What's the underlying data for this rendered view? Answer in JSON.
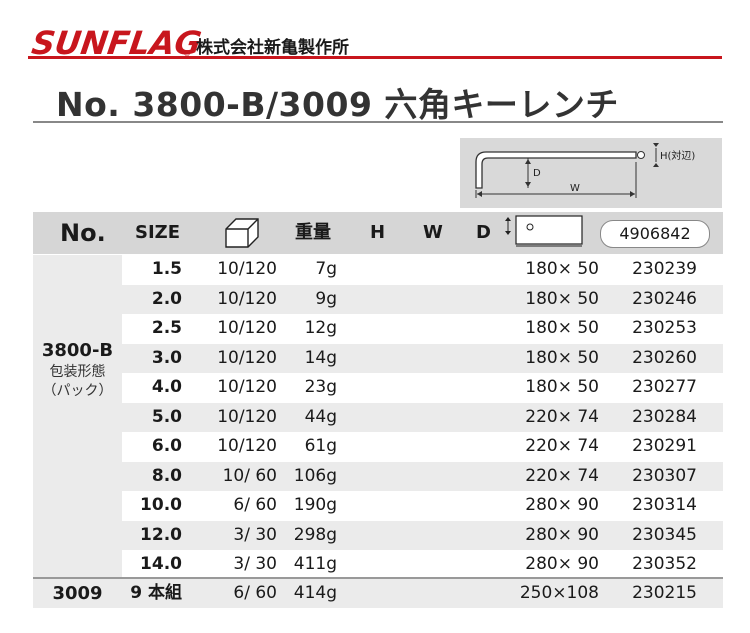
{
  "header": {
    "brand": "SUNFLAG",
    "registered_mark": "®",
    "company": "株式会社新亀製作所"
  },
  "title": "No. 3800-B/3009 六角キーレンチ",
  "diagram": {
    "h_label": "H(対辺)",
    "d_label": "D",
    "w_label": "W"
  },
  "table": {
    "headers": {
      "no": "No.",
      "size": "SIZE",
      "weight": "重量",
      "h": "H",
      "w": "W",
      "d": "D",
      "barcode_prefix": "4906842"
    },
    "groups": [
      {
        "model": "3800-B",
        "note_line1": "包装形態",
        "note_line2": "（パック）"
      },
      {
        "model": "3009"
      }
    ],
    "rows": [
      {
        "size": "1.5",
        "pack": "10/120",
        "weight": "7g",
        "dims": "180× 50",
        "code": "230239"
      },
      {
        "size": "2.0",
        "pack": "10/120",
        "weight": "9g",
        "dims": "180× 50",
        "code": "230246"
      },
      {
        "size": "2.5",
        "pack": "10/120",
        "weight": "12g",
        "dims": "180× 50",
        "code": "230253"
      },
      {
        "size": "3.0",
        "pack": "10/120",
        "weight": "14g",
        "dims": "180× 50",
        "code": "230260"
      },
      {
        "size": "4.0",
        "pack": "10/120",
        "weight": "23g",
        "dims": "180× 50",
        "code": "230277"
      },
      {
        "size": "5.0",
        "pack": "10/120",
        "weight": "44g",
        "dims": "220× 74",
        "code": "230284"
      },
      {
        "size": "6.0",
        "pack": "10/120",
        "weight": "61g",
        "dims": "220× 74",
        "code": "230291"
      },
      {
        "size": "8.0",
        "pack": "10/ 60",
        "weight": "106g",
        "dims": "220× 74",
        "code": "230307"
      },
      {
        "size": "10.0",
        "pack": "6/ 60",
        "weight": "190g",
        "dims": "280× 90",
        "code": "230314"
      },
      {
        "size": "12.0",
        "pack": "3/ 30",
        "weight": "298g",
        "dims": "280× 90",
        "code": "230345"
      },
      {
        "size": "14.0",
        "pack": "3/ 30",
        "weight": "411g",
        "dims": "280× 90",
        "code": "230352"
      },
      {
        "size": "9 本組",
        "pack": "6/ 60",
        "weight": "414g",
        "dims": "250×108",
        "code": "230215"
      }
    ]
  },
  "colors": {
    "brand_red": "#c8161d",
    "header_gray": "#d6d6d6",
    "stripe_gray": "#ebebeb"
  }
}
